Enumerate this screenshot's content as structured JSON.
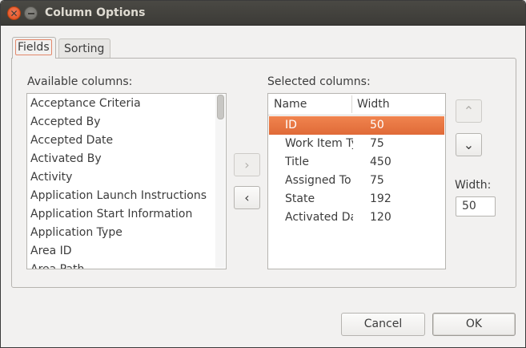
{
  "window": {
    "title": "Column Options"
  },
  "tabs": [
    {
      "label": "Fields",
      "active": true
    },
    {
      "label": "Sorting",
      "active": false
    }
  ],
  "available": {
    "label": "Available columns:",
    "items": [
      "Acceptance Criteria",
      "Accepted By",
      "Accepted Date",
      "Activated By",
      "Activity",
      "Application Launch Instructions",
      "Application Start Information",
      "Application Type",
      "Area ID",
      "Area Path"
    ]
  },
  "move_buttons": {
    "add": "›",
    "remove": "‹"
  },
  "selected": {
    "label": "Selected columns:",
    "headers": {
      "name": "Name",
      "width": "Width"
    },
    "rows": [
      {
        "name": "ID",
        "width": "50",
        "selected": true
      },
      {
        "name": "Work Item Type",
        "width": "75",
        "selected": false
      },
      {
        "name": "Title",
        "width": "450",
        "selected": false
      },
      {
        "name": "Assigned To",
        "width": "75",
        "selected": false
      },
      {
        "name": "State",
        "width": "192",
        "selected": false
      },
      {
        "name": "Activated Date",
        "width": "120",
        "selected": false
      }
    ]
  },
  "order_buttons": {
    "up": "⌃",
    "down": "⌄"
  },
  "width_field": {
    "label": "Width:",
    "value": "50"
  },
  "footer": {
    "cancel": "Cancel",
    "ok": "OK"
  },
  "colors": {
    "selection": "#e9743e",
    "titlebar": "#3c3b37",
    "close": "#e95420"
  }
}
